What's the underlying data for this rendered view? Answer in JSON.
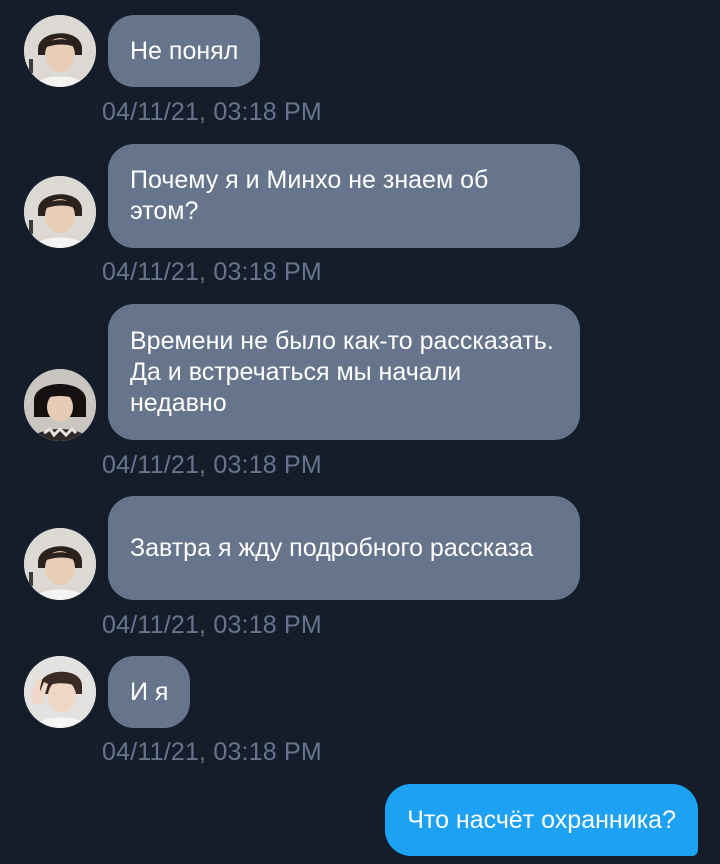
{
  "messages": [
    {
      "sender": "contact-a",
      "text": "Не понял",
      "time": "04/11/21, 03:18 PM"
    },
    {
      "sender": "contact-a",
      "text": "Почему я и Минхо не знаем об этом?",
      "time": "04/11/21, 03:18 PM"
    },
    {
      "sender": "contact-b",
      "text": "Времени не было как-то рассказать. Да и встречаться мы начали недавно",
      "time": "04/11/21, 03:18 PM"
    },
    {
      "sender": "contact-a",
      "text": "Завтра я жду подробного рассказа",
      "time": "04/11/21, 03:18 PM"
    },
    {
      "sender": "contact-c",
      "text": "И я",
      "time": "04/11/21, 03:18 PM"
    }
  ],
  "outgoing": {
    "text": "Что насчёт охранника?"
  },
  "colors": {
    "background": "#151d2b",
    "incoming_bubble": "#66758b",
    "outgoing_bubble": "#1da1f2",
    "timestamp": "#66758b"
  }
}
